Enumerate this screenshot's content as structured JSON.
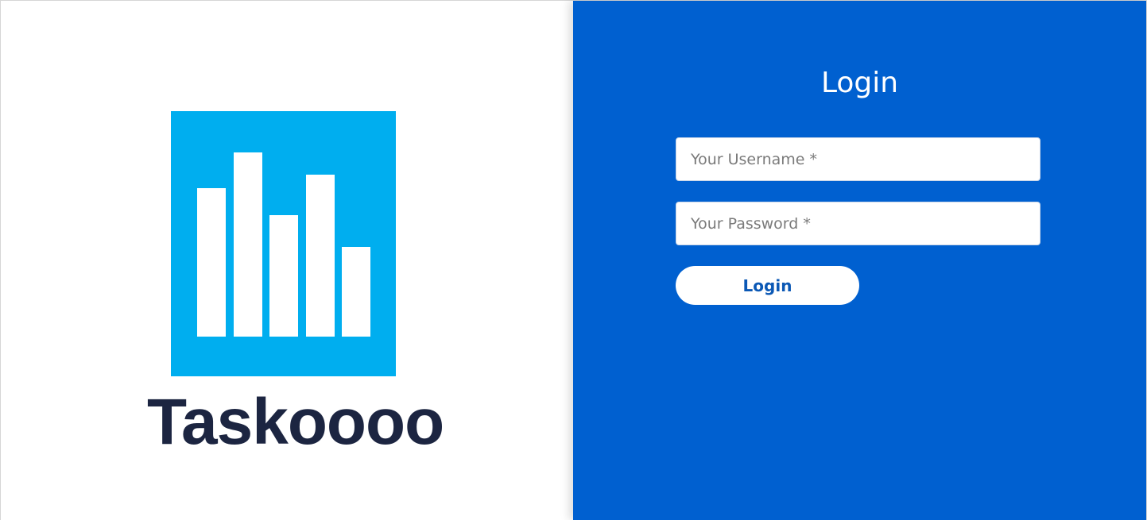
{
  "brand": {
    "name": "Taskoooo",
    "logo_icon": "bar-chart-icon",
    "logo_color": "#00AEEF",
    "text_color": "#1C2541"
  },
  "login": {
    "title": "Login",
    "username_placeholder": "Your Username *",
    "password_placeholder": "Your Password *",
    "username_value": "",
    "password_value": "",
    "submit_label": "Login",
    "panel_color": "#0060D0"
  }
}
